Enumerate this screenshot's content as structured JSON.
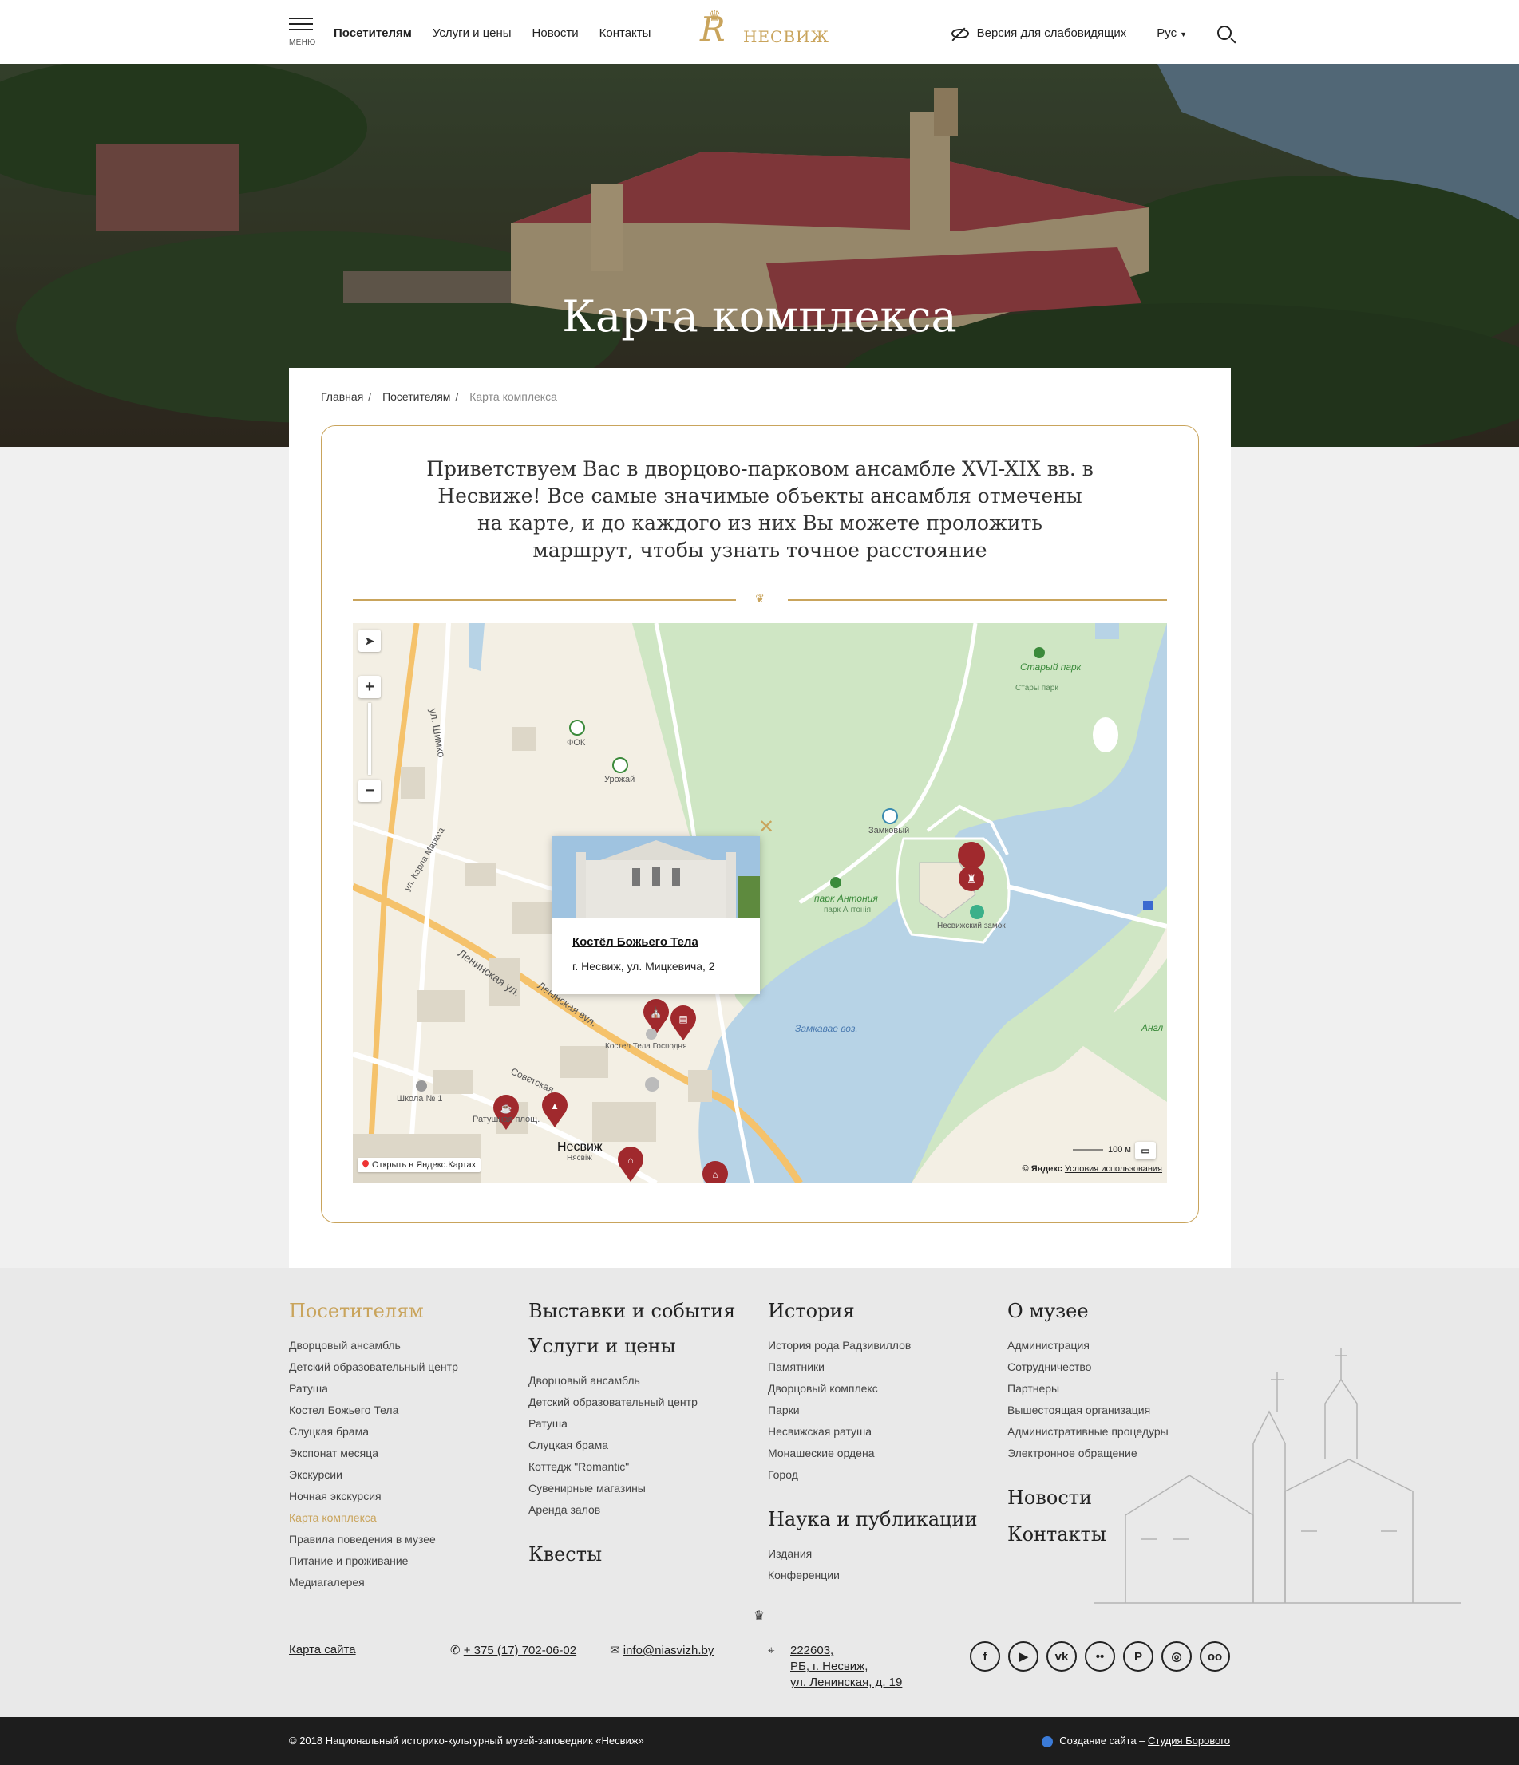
{
  "header": {
    "menu_label": "МЕНЮ",
    "nav": [
      "Посетителям",
      "Услуги и цены",
      "Новости",
      "Контакты"
    ],
    "logo_text": "НЕСВИЖ",
    "accessibility": "Версия для слабовидящих",
    "language": "Рус"
  },
  "hero": {
    "title": "Карта комплекса"
  },
  "breadcrumbs": [
    "Главная",
    "Посетителям",
    "Карта комплекса"
  ],
  "intro": "Приветствуем Вас в дворцово-парковом ансамбле XVI-XIX вв. в Несвиже! Все самые значимые объекты ансамбля отмечены на карте, и до каждого из них Вы можете проложить маршрут, чтобы узнать точное расстояние",
  "map": {
    "popup": {
      "title": "Костёл Божьего Тела",
      "address": "г. Несвиж, ул. Мицкевича, 2"
    },
    "labels": {
      "fok": "ФОК",
      "urozhai": "Урожай",
      "zamkovy": "Замковый",
      "park_antonia": "парк Антония",
      "park_antonia_by": "парк Антонія",
      "nesvizh_castle": "Несвижский замок",
      "stary_park": "Старый парк",
      "stary_park_by": "Стары парк",
      "lake": "Замкавае воз.",
      "kostel": "Костел Тела Господня",
      "school": "Школа № 1",
      "ratush": "Ратушная площ.",
      "city": "Несвиж",
      "city_by": "Нясвіж",
      "street_leninskaya": "Ленинская ул.",
      "street_leninskaya_by": "Ленінская вул.",
      "street_karla_marksa": "ул. Карла Маркса",
      "street_shimko": "ул. Шимко",
      "street_sovetskaya": "Советская",
      "angl": "Англ"
    },
    "open_yandex": "Открыть в Яндекс.Картах",
    "copyright": "© Яндекс",
    "terms": "Условия использования",
    "scale": "100 м",
    "colors": {
      "water": "#b7d3e6",
      "park": "#cfe6c4",
      "road": "#ffffff",
      "major_road": "#f5c26b",
      "marker": "#a0292d"
    }
  },
  "footer": {
    "visitors": {
      "title": "Посетителям",
      "items": [
        "Дворцовый ансамбль",
        "Детский образовательный центр",
        "Ратуша",
        "Костел Божьего Тела",
        "Слуцкая брама",
        "Экспонат месяца",
        "Экскурсии",
        "Ночная экскурсия",
        "Карта комплекса",
        "Правила поведения в музее",
        "Питание и проживание",
        "Медиагалерея"
      ]
    },
    "exhibitions": {
      "title": "Выставки и события"
    },
    "services": {
      "title": "Услуги и цены",
      "items": [
        "Дворцовый ансамбль",
        "Детский образовательный центр",
        "Ратуша",
        "Слуцкая брама",
        "Коттедж \"Romantic\"",
        "Сувенирные магазины",
        "Аренда залов"
      ]
    },
    "quests": {
      "title": "Квесты"
    },
    "history": {
      "title": "История",
      "items": [
        "История рода Радзивиллов",
        "Памятники",
        "Дворцовый комплекс",
        "Парки",
        "Несвижская ратуша",
        "Монашеские ордена",
        "Город"
      ]
    },
    "science": {
      "title": "Наука и публикации",
      "items": [
        "Издания",
        "Конференции"
      ]
    },
    "about": {
      "title": "О музее",
      "items": [
        "Администрация",
        "Сотрудничество",
        "Партнеры",
        "Вышестоящая организация",
        "Административные процедуры",
        "Электронное обращение"
      ]
    },
    "news": "Новости",
    "contacts": "Контакты",
    "sitemap": "Карта сайта",
    "phone": "+ 375 (17) 702-06-02",
    "email": "info@niasvizh.by",
    "address_line1": "222603,",
    "address_line2": "РБ, г. Несвиж,",
    "address_line3": "ул. Ленинская, д. 19",
    "social": [
      "facebook-icon",
      "youtube-icon",
      "vk-icon",
      "flickr-icon",
      "pinterest-icon",
      "instagram-icon",
      "tripadvisor-icon"
    ]
  },
  "copyright": {
    "text": "© 2018 Национальный историко-культурный музей-заповедник «Несвиж»",
    "created_prefix": "Создание сайта –",
    "studio": "Студия Борового"
  },
  "accent_color": "#c9a45c"
}
